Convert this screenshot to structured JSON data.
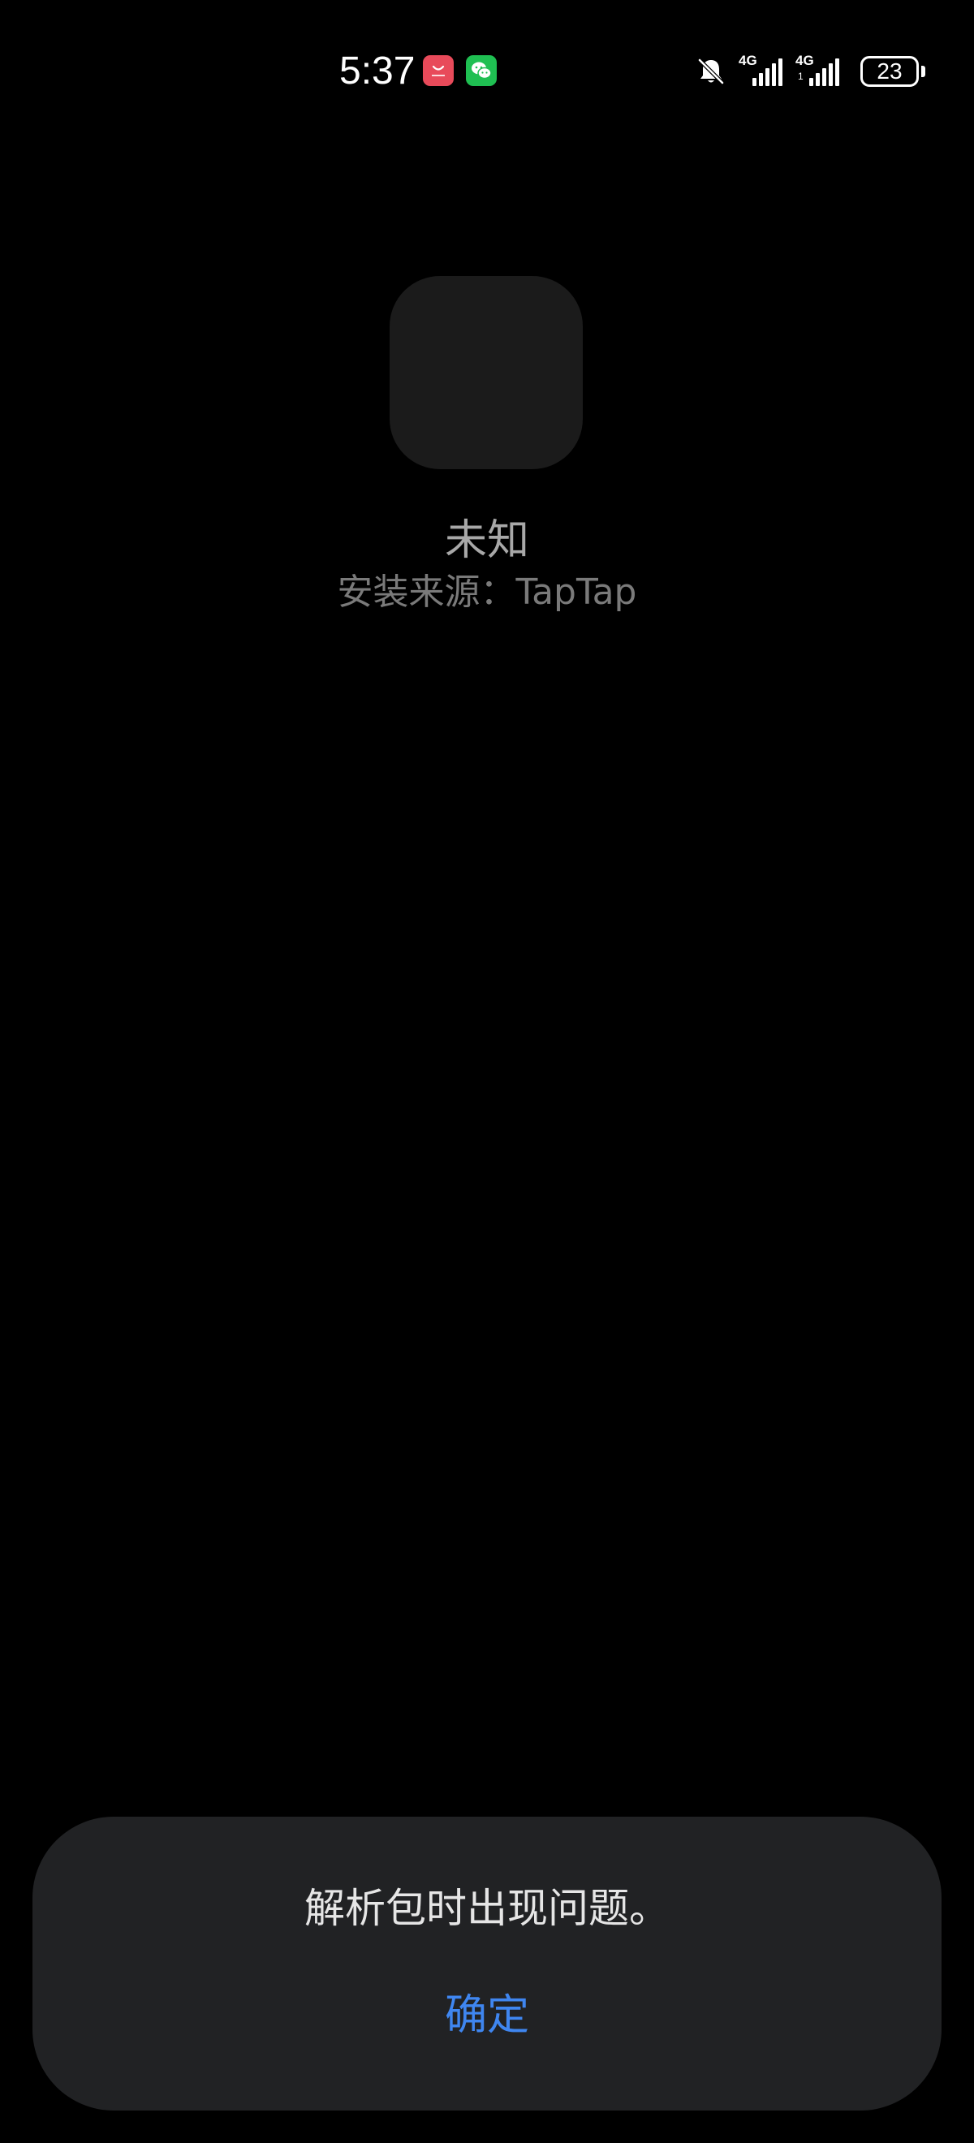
{
  "status_bar": {
    "time": "5:37",
    "notification_icons": [
      "huawei-appgallery-icon",
      "wechat-icon"
    ],
    "mute_icon": "bell-off-icon",
    "sim1": {
      "tech": "4G"
    },
    "sim2": {
      "tech": "4G",
      "sub": "1"
    },
    "battery_level": "23"
  },
  "app": {
    "name": "未知",
    "install_source": "安装来源：TapTap"
  },
  "dialog": {
    "message": "解析包时出现问题。",
    "confirm_label": "确定"
  },
  "colors": {
    "background": "#000000",
    "app_icon_placeholder": "#1b1b1b",
    "dialog_background": "#212224",
    "accent": "#3f86f0",
    "huawei_red": "#e84a5a",
    "wechat_green": "#1fbf52"
  }
}
